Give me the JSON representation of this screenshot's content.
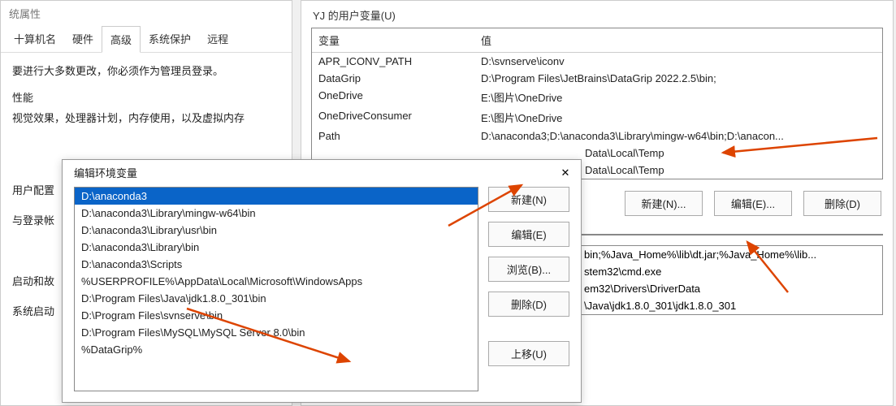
{
  "sysprops": {
    "title": "统属性",
    "tabs": {
      "computer_name": "十算机名",
      "hardware": "硬件",
      "advanced": "高级",
      "system_protect": "系统保护",
      "remote": "远程"
    },
    "hint": "要进行大多数更改，你必须作为管理员登录。",
    "perf_title": "性能",
    "perf_desc": "视觉效果，处理器计划，内存使用，以及虚拟内存",
    "userprofile_title": "用户配置",
    "userprofile_desc": "与登录帐",
    "startup_title": "启动和故",
    "startup_desc": "系统启动"
  },
  "envvars": {
    "user_group_label": "YJ 的用户变量(U)",
    "col_name": "变量",
    "col_value": "值",
    "user_rows": [
      {
        "name": "APR_ICONV_PATH",
        "value": "D:\\svnserve\\iconv"
      },
      {
        "name": "DataGrip",
        "value": "D:\\Program Files\\JetBrains\\DataGrip 2022.2.5\\bin;"
      },
      {
        "name": "OneDrive",
        "value": "E:\\图片\\OneDrive"
      },
      {
        "name": "OneDriveConsumer",
        "value": "E:\\图片\\OneDrive"
      },
      {
        "name": "Path",
        "value": "D:\\anaconda3;D:\\anaconda3\\Library\\mingw-w64\\bin;D:\\anacon..."
      }
    ],
    "partial_rows": [
      {
        "value": "Data\\Local\\Temp"
      },
      {
        "value": "Data\\Local\\Temp"
      }
    ],
    "btn_new": "新建(N)...",
    "btn_edit": "编辑(E)...",
    "btn_delete": "删除(D)",
    "system_partial_rows": [
      "bin;%Java_Home%\\lib\\dt.jar;%Java_Home%\\lib...",
      "stem32\\cmd.exe",
      "em32\\Drivers\\DriverData",
      "\\Java\\jdk1.8.0_301\\jdk1.8.0_301"
    ]
  },
  "editpath": {
    "title": "编辑环境变量",
    "close_icon": "✕",
    "items": [
      "D:\\anaconda3",
      "D:\\anaconda3\\Library\\mingw-w64\\bin",
      "D:\\anaconda3\\Library\\usr\\bin",
      "D:\\anaconda3\\Library\\bin",
      "D:\\anaconda3\\Scripts",
      "%USERPROFILE%\\AppData\\Local\\Microsoft\\WindowsApps",
      "D:\\Program Files\\Java\\jdk1.8.0_301\\bin",
      "D:\\Program Files\\svnserve\\bin",
      "D:\\Program Files\\MySQL\\MySQL Server 8.0\\bin",
      "%DataGrip%"
    ],
    "btns": {
      "new": "新建(N)",
      "edit": "编辑(E)",
      "browse": "浏览(B)...",
      "delete": "删除(D)",
      "moveup": "上移(U)"
    }
  }
}
